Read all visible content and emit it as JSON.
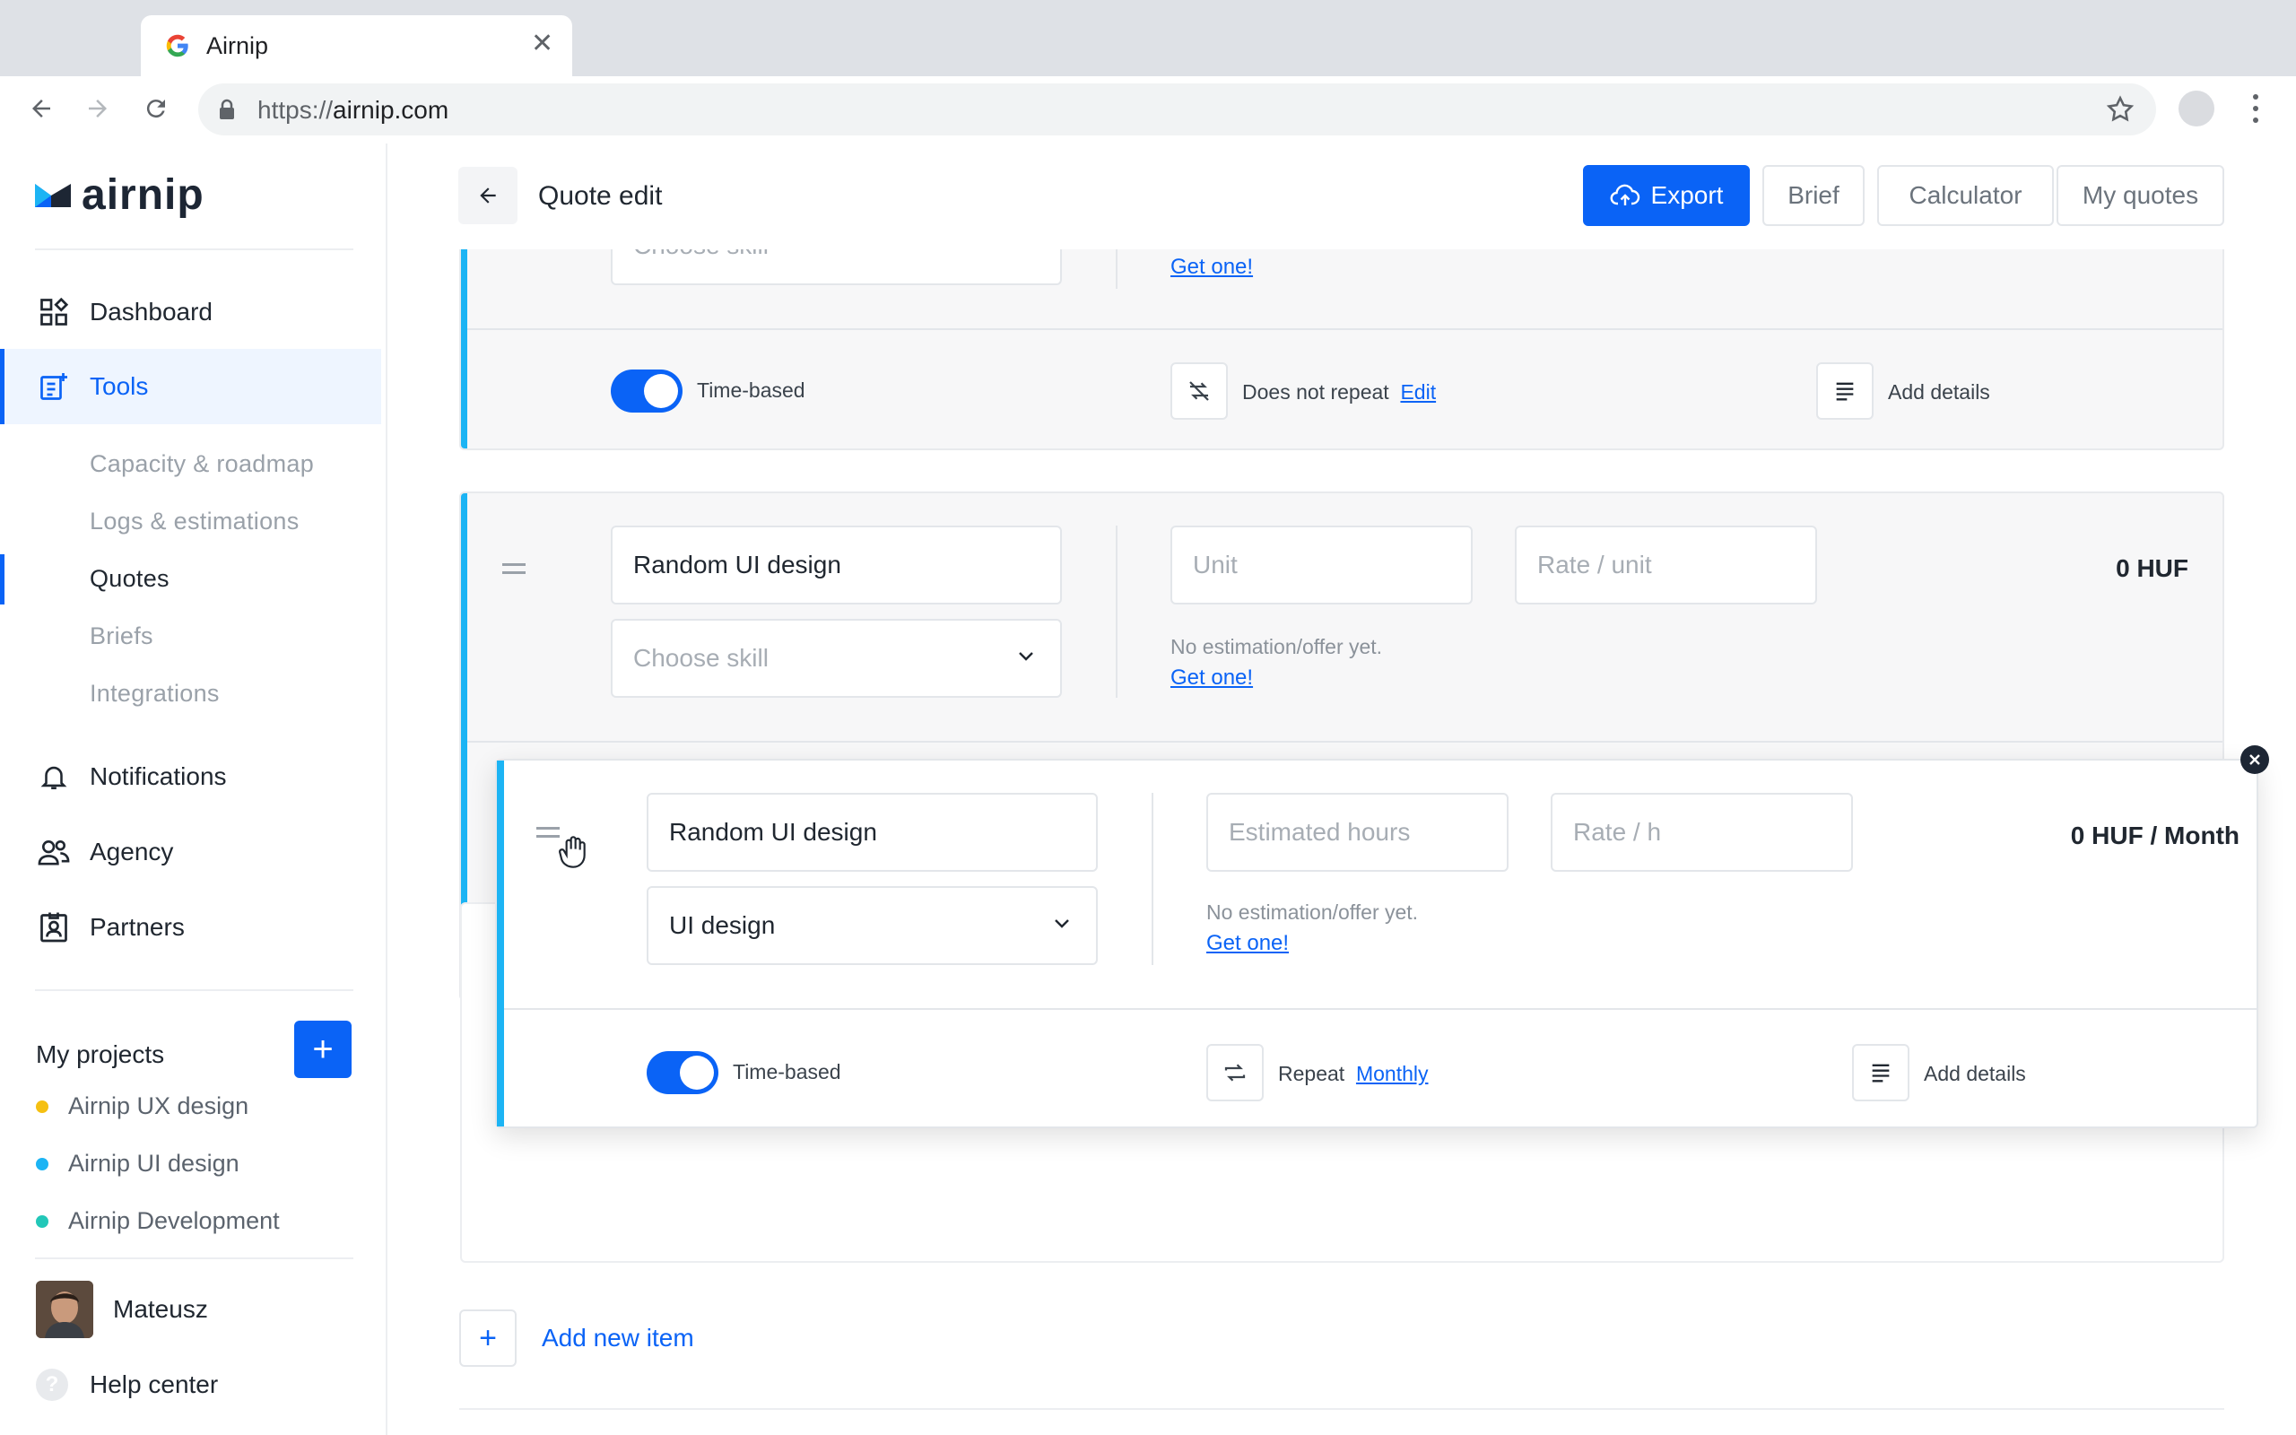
{
  "browser": {
    "tab_title": "Airnip",
    "tab_close": "✕",
    "url_scheme": "https://",
    "url_host": "airnip.com"
  },
  "brand": {
    "logo_text": "airnip",
    "accent": "#0a63f6",
    "card_accent": "#1cb4f4"
  },
  "sidebar": {
    "nav": [
      {
        "label": "Dashboard",
        "icon": "dashboard-icon"
      },
      {
        "label": "Tools",
        "icon": "tools-icon",
        "active": true
      }
    ],
    "tools_sub": [
      "Capacity & roadmap",
      "Logs & estimations",
      "Quotes",
      "Briefs",
      "Integrations"
    ],
    "active_sub": "Quotes",
    "nav2": [
      {
        "label": "Notifications",
        "icon": "bell-icon"
      },
      {
        "label": "Agency",
        "icon": "people-icon"
      },
      {
        "label": "Partners",
        "icon": "badge-icon"
      }
    ],
    "projects_title": "My projects",
    "add_project": "+",
    "projects": [
      {
        "name": "Airnip UX design",
        "color": "#f5c012"
      },
      {
        "name": "Airnip UI design",
        "color": "#1cb4f4"
      },
      {
        "name": "Airnip Development",
        "color": "#22c7b8"
      }
    ],
    "user_name": "Mateusz",
    "help_label": "Help center",
    "help_glyph": "?"
  },
  "header": {
    "title": "Quote edit",
    "buttons": {
      "export": "Export",
      "brief": "Brief",
      "calculator": "Calculator",
      "my_quotes": "My quotes"
    }
  },
  "item_top": {
    "skill_placeholder": "Choose skill",
    "get_one": "Get one!",
    "time_based": "Time-based",
    "repeat_text": "Does not repeat",
    "repeat_link": "Edit",
    "add_details": "Add details"
  },
  "item_middle": {
    "name": "Random UI design",
    "skill_placeholder": "Choose skill",
    "unit_placeholder": "Unit",
    "rate_placeholder": "Rate / unit",
    "no_estimation": "No estimation/offer yet.",
    "get_one": "Get one!",
    "total": "0 HUF"
  },
  "item_dragging": {
    "name": "Random UI design",
    "skill": "UI design",
    "hours_placeholder": "Estimated hours",
    "rate_placeholder": "Rate / h",
    "no_estimation": "No estimation/offer yet.",
    "get_one": "Get one!",
    "total": "0 HUF / Month",
    "time_based": "Time-based",
    "repeat_text": "Repeat",
    "repeat_link": "Monthly",
    "add_details": "Add details"
  },
  "footer": {
    "add_item": "Add new item",
    "add_glyph": "+"
  }
}
